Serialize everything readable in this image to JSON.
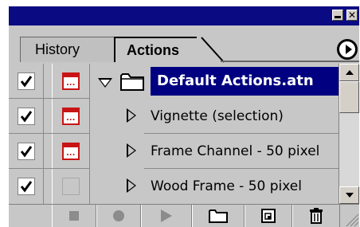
{
  "window": {
    "minimize_icon": "minimize-icon",
    "close_icon": "close-icon"
  },
  "tabs": [
    {
      "label": "History",
      "active": false
    },
    {
      "label": "Actions",
      "active": true
    }
  ],
  "palette_menu_icon": "palette-menu-arrow-icon",
  "list": {
    "rows": [
      {
        "type": "set",
        "label": "Default Actions.atn",
        "checked": true,
        "dialog": true,
        "expanded": true,
        "selected": true
      },
      {
        "type": "action",
        "label": "Vignette (selection)",
        "checked": true,
        "dialog": true,
        "expanded": false
      },
      {
        "type": "action",
        "label": "Frame Channel - 50 pixel",
        "checked": true,
        "dialog": true,
        "expanded": false
      },
      {
        "type": "action",
        "label": "Wood Frame - 50 pixel",
        "checked": true,
        "dialog": false,
        "expanded": false
      }
    ]
  },
  "toolbar": {
    "buttons": [
      "stop-icon",
      "record-icon",
      "play-icon",
      "new-set-icon",
      "new-action-icon",
      "delete-icon"
    ]
  },
  "colors": {
    "title_bar": "#0a0a82",
    "selection": "#000080",
    "dialog_red": "#c81414",
    "panel": "#c7c7c7"
  }
}
